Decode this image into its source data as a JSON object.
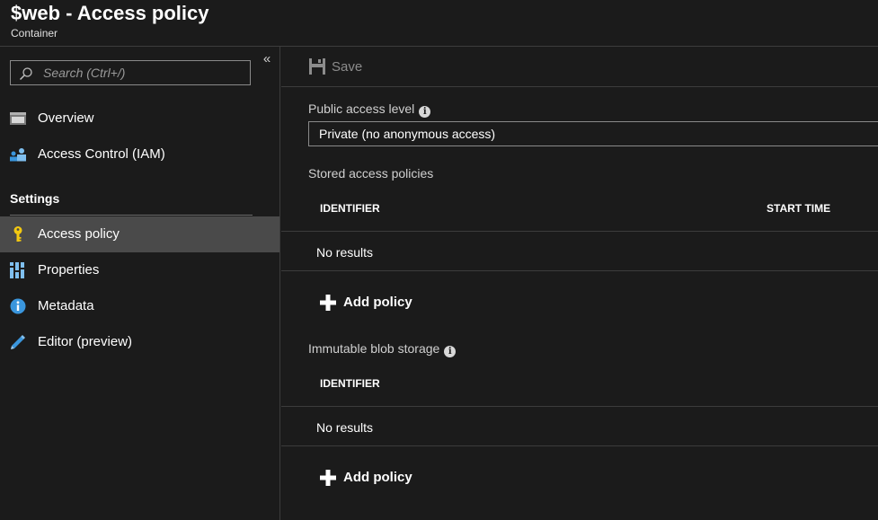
{
  "header": {
    "title": "$web - Access policy",
    "subtitle": "Container"
  },
  "sidebar": {
    "search_placeholder": "Search (Ctrl+/)",
    "collapse_glyph": "«",
    "items": [
      {
        "label": "Overview",
        "icon": "overview-icon"
      },
      {
        "label": "Access Control (IAM)",
        "icon": "people-icon"
      }
    ],
    "section_title": "Settings",
    "settings_items": [
      {
        "label": "Access policy",
        "icon": "key-icon",
        "active": true
      },
      {
        "label": "Properties",
        "icon": "properties-icon"
      },
      {
        "label": "Metadata",
        "icon": "info-icon"
      },
      {
        "label": "Editor (preview)",
        "icon": "pencil-icon"
      }
    ]
  },
  "toolbar": {
    "save_label": "Save"
  },
  "main": {
    "public_access_label": "Public access level",
    "public_access_value": "Private (no anonymous access)",
    "stored_policies": {
      "title": "Stored access policies",
      "columns": [
        "IDENTIFIER",
        "START TIME"
      ],
      "empty_text": "No results",
      "add_label": "Add policy"
    },
    "immutable_storage": {
      "title": "Immutable blob storage",
      "columns": [
        "IDENTIFIER"
      ],
      "empty_text": "No results",
      "add_label": "Add policy"
    }
  },
  "colors": {
    "background": "#1b1b1b",
    "active_item": "#4a4a4a",
    "accent_blue": "#3a96dd",
    "key_yellow": "#f2c811"
  }
}
